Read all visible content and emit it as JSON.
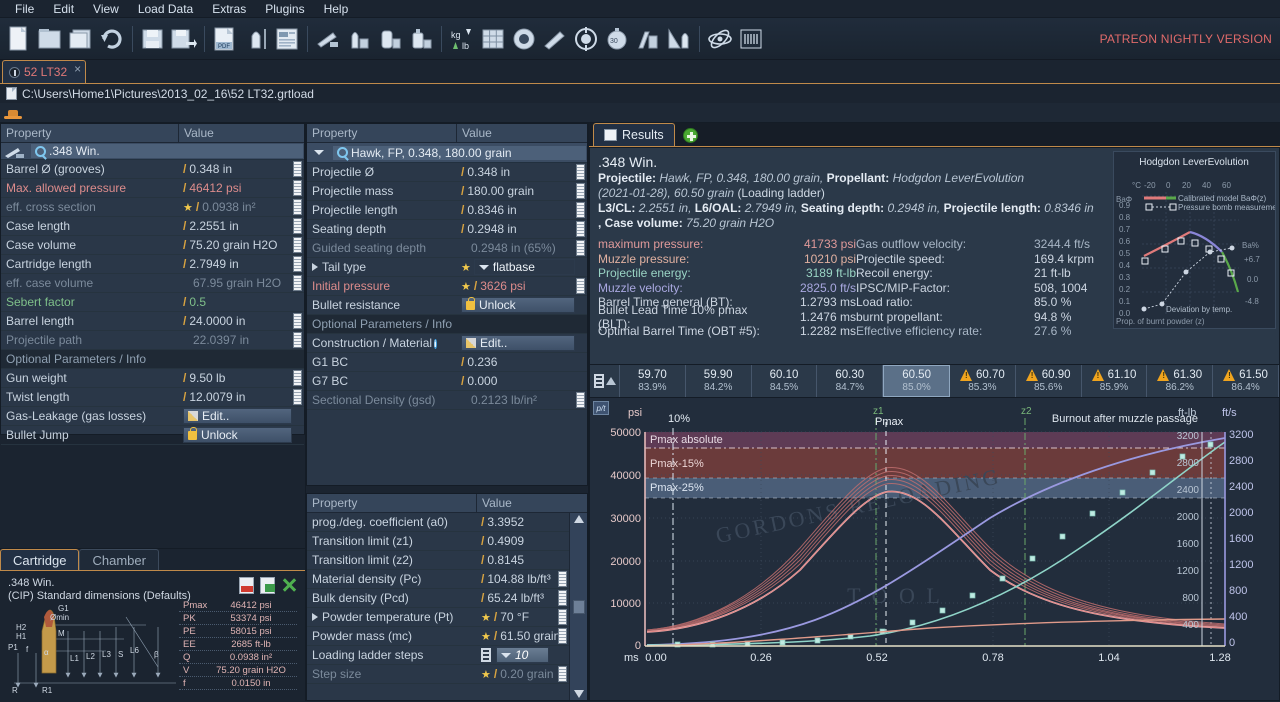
{
  "menu": {
    "items": [
      "File",
      "Edit",
      "View",
      "Load Data",
      "Extras",
      "Plugins",
      "Help"
    ]
  },
  "toolbar": {
    "patreon_label": "PATREON NIGHTLY VERSION",
    "icons": [
      "new-document-icon",
      "open-folder-icon",
      "open-recent-icon",
      "reload-icon",
      "save-icon",
      "save-as-icon",
      "export-pdf-icon",
      "cartridge-measure-icon",
      "report-icon",
      "rifle-icon",
      "bullets-icon",
      "case-icon",
      "powder-container-icon",
      "unit-convert-icon",
      "table-grid-icon",
      "primer-icon",
      "scope-icon",
      "target-icon",
      "chronograph-icon",
      "powder-mix-icon",
      "caliper-icon",
      "atom-icon",
      "strain-gauge-icon"
    ]
  },
  "document_tab": {
    "label": "52 LT32",
    "close": "×"
  },
  "path": "C:\\Users\\Home1\\Pictures\\2013_02_16\\52 LT32.grtload",
  "left_panel": {
    "header": {
      "property": "Property",
      "value": "Value"
    },
    "title": ".348 Win.",
    "rows": [
      {
        "name": "Barrel Ø (grooves)",
        "value": "0.348 in",
        "slash": true,
        "ruler": true
      },
      {
        "name": "Max. allowed pressure",
        "value": "46412 psi",
        "slash": true,
        "ruler": true,
        "style": "red"
      },
      {
        "name": "eff. cross section",
        "value": "0.0938 in²",
        "slash": true,
        "ruler": true,
        "star": true,
        "style": "muted"
      },
      {
        "name": "Case length",
        "value": "2.2551 in",
        "slash": true,
        "ruler": true
      },
      {
        "name": "Case volume",
        "value": "75.20 grain H2O",
        "slash": true,
        "ruler": true
      },
      {
        "name": "Cartridge length",
        "value": "2.7949 in",
        "slash": true,
        "ruler": true
      },
      {
        "name": "eff. case volume",
        "value": "67.95 grain H2O",
        "slash": false,
        "ruler": true,
        "style": "muted"
      },
      {
        "name": "Sebert factor",
        "value": "0.5",
        "slash": true,
        "ruler": false,
        "style": "green"
      },
      {
        "name": "Barrel length",
        "value": "24.0000 in",
        "slash": true,
        "ruler": true
      },
      {
        "name": "Projectile path",
        "value": "22.0397 in",
        "slash": false,
        "ruler": true,
        "style": "muted"
      },
      {
        "name": "Optional Parameters / Info",
        "separator": true
      },
      {
        "name": "Gun weight",
        "value": "9.50 lb",
        "slash": true,
        "ruler": true
      },
      {
        "name": "Twist length",
        "value": "12.0079 in",
        "slash": true,
        "ruler": true
      },
      {
        "name": "Gas-Leakage (gas losses)",
        "button": "Edit..",
        "button_type": "edit"
      },
      {
        "name": "Bullet Jump",
        "button": "Unlock",
        "button_type": "lock"
      }
    ]
  },
  "cartridge_panel": {
    "tabs": [
      {
        "label": "Cartridge",
        "active": true
      },
      {
        "label": "Chamber",
        "active": false
      }
    ],
    "title_line1": ".348 Win.",
    "title_line2": "(CIP) Standard dimensions (Defaults)",
    "diagram_labels": [
      "G1",
      "Ømin",
      "H2",
      "H1",
      "M",
      "P1",
      "f",
      "α",
      "L1",
      "L2",
      "L3",
      "S",
      "L6",
      "β",
      "R",
      "R1"
    ],
    "table": [
      {
        "k": "Pmax",
        "v": "46412 psi"
      },
      {
        "k": "PK",
        "v": "53374 psi"
      },
      {
        "k": "PE",
        "v": "58015 psi"
      },
      {
        "k": "EE",
        "v": "2685 ft-lb"
      },
      {
        "k": "Q",
        "v": "0.0938 in²"
      },
      {
        "k": "V",
        "v": "75.20 grain H2O"
      },
      {
        "k": "f",
        "v": "0.0150 in"
      }
    ],
    "icons": [
      "export-pdf-icon",
      "export-sheet-icon",
      "close-x-icon"
    ]
  },
  "mid_panel": {
    "header": {
      "property": "Property",
      "value": "Value"
    },
    "title": "Hawk, FP, 0.348, 180.00 grain",
    "rows": [
      {
        "name": "Projectile Ø",
        "value": "0.348 in",
        "slash": true,
        "ruler": true
      },
      {
        "name": "Projectile mass",
        "value": "180.00 grain",
        "slash": true,
        "ruler": true
      },
      {
        "name": "Projectile length",
        "value": "0.8346 in",
        "slash": true,
        "ruler": true
      },
      {
        "name": "Seating depth",
        "value": "0.2948 in",
        "slash": true,
        "ruler": true
      },
      {
        "name": "Guided seating depth",
        "value": "0.2948 in (65%)",
        "slash": false,
        "ruler": true,
        "style": "muted"
      },
      {
        "name": "Tail type",
        "combo": "flatbase",
        "star": true,
        "expander": true
      },
      {
        "name": "Initial pressure",
        "value": "3626 psi",
        "slash": true,
        "ruler": true,
        "star": true,
        "style": "red"
      },
      {
        "name": "Bullet resistance",
        "button": "Unlock",
        "button_type": "lock"
      },
      {
        "name": "Optional Parameters / Info",
        "separator": true
      },
      {
        "name": "Construction / Material",
        "button": "Edit..",
        "button_type": "edit",
        "info": true
      },
      {
        "name": "G1 BC",
        "value": "0.236",
        "slash": true
      },
      {
        "name": "G7 BC",
        "value": "0.000",
        "slash": true
      },
      {
        "name": "Sectional Density (gsd)",
        "value": "0.2123 lb/in²",
        "slash": false,
        "ruler": true,
        "style": "muted"
      }
    ]
  },
  "powder_panel": {
    "header": {
      "property": "Property",
      "value": "Value"
    },
    "rows": [
      {
        "name": "prog./deg. coefficient (a0)",
        "value": "3.3952",
        "slash": true
      },
      {
        "name": "Transition limit (z1)",
        "value": "0.4909",
        "slash": true
      },
      {
        "name": "Transition limit (z2)",
        "value": "0.8145",
        "slash": true
      },
      {
        "name": "Material density (Pc)",
        "value": "104.88 lb/ft³",
        "slash": true,
        "ruler": true
      },
      {
        "name": "Bulk density (Pcd)",
        "value": "65.24 lb/ft³",
        "slash": true,
        "ruler": true
      },
      {
        "name": "Powder temperature (Pt)",
        "value": "70 °F",
        "slash": true,
        "ruler": true,
        "star": true,
        "expander": true
      },
      {
        "name": "Powder mass (mc)",
        "value": "61.50 grain",
        "slash": true,
        "ruler": true,
        "star": true
      },
      {
        "name": "Loading ladder steps",
        "combo": "10",
        "ladder_icon": true
      },
      {
        "name": "Step size",
        "value": "0.20 grain",
        "slash": true,
        "ruler": true,
        "star": true,
        "style": "muted"
      }
    ]
  },
  "results": {
    "tab_label": "Results",
    "add_tab": "+",
    "title": ".348 Win.",
    "desc": {
      "l1_k1": "Projectile:",
      "l1_v1": "Hawk, FP, 0.348, 180.00 grain,",
      "l1_k2": "Propellant:",
      "l1_v2": "Hodgdon LeverEvolution",
      "l2_v": "(2021-01-28), 60.50 grain",
      "l2_t": "(Loading ladder)",
      "l3_k1": "L3/CL:",
      "l3_v1": "2.2551 in,",
      "l3_k2": "L6/OAL:",
      "l3_v2": "2.7949 in,",
      "l3_k3": "Seating depth:",
      "l3_v3": "0.2948 in,",
      "l3_k4": "Projectile length:",
      "l3_v4": "0.8346 in",
      "l4_k": ", Case volume:",
      "l4_v": "75.20 grain H2O"
    },
    "left_kv": [
      {
        "k": "maximum pressure:",
        "v": "41733 psi",
        "color": "#e09a9a"
      },
      {
        "k": "Muzzle pressure:",
        "v": "10210 psi",
        "color": "#e0b0a0"
      },
      {
        "k": "Projectile energy:",
        "v": "3189 ft-lb",
        "color": "#9ad4c4"
      },
      {
        "k": "Muzzle velocity:",
        "v": "2825.0 ft/s",
        "color": "#a9a8e0"
      },
      {
        "k": "Barrel Time general (BT):",
        "v": "1.2793 ms",
        "color": "#cdd6e2"
      },
      {
        "k": "Bullet Lead Time 10% pmax (BLT):",
        "v": "1.2476 ms",
        "color": "#cdd6e2"
      },
      {
        "k": "Optimal Barrel Time (OBT #5):",
        "v": "1.2282 ms",
        "color": "#cdd6e2"
      }
    ],
    "right_kv": [
      {
        "k": "Gas outflow velocity:",
        "v": "3244.4 ft/s",
        "color": "#a8b6c6"
      },
      {
        "k": "Projectile speed:",
        "v": "169.4 krpm",
        "color": "#cdd6e2"
      },
      {
        "k": "Recoil energy:",
        "v": "21 ft-lb",
        "color": "#cdd6e2"
      },
      {
        "k": "IPSC/MIP-Factor:",
        "v": "508, 1004",
        "color": "#cdd6e2"
      },
      {
        "k": "Load ratio:",
        "v": "85.0 %",
        "color": "#cdd6e2"
      },
      {
        "k": "burnt propellant:",
        "v": "94.8 %",
        "color": "#cdd6e2"
      },
      {
        "k": "Effective efficiency rate:",
        "v": "27.6 %",
        "color": "#a8b6c6"
      }
    ]
  },
  "inset_chart": {
    "title": "Hodgdon LeverEvolution",
    "y_label": "BaΦ",
    "x_label": "Prop. of burnt powder (z)",
    "temp_unit": "°C",
    "x_ticks": [
      "-20",
      "0",
      "20",
      "40",
      "60"
    ],
    "y_ticks": [
      "0.9",
      "0.8",
      "0.7",
      "0.6",
      "0.5",
      "0.4",
      "0.3",
      "0.2",
      "0.1",
      "0.0"
    ],
    "right_label": "Ba%",
    "right_ticks": [
      "+6.7",
      "0.0",
      "-4.8"
    ],
    "legend": [
      "Calibrated model BaΦ(z)",
      "Pressure bomb measurement"
    ],
    "annotation": "Deviation by temp."
  },
  "ladder": {
    "cells": [
      {
        "charge": "59.70",
        "pct": "83.9%",
        "warn": false,
        "selected": false
      },
      {
        "charge": "59.90",
        "pct": "84.2%",
        "warn": false,
        "selected": false
      },
      {
        "charge": "60.10",
        "pct": "84.5%",
        "warn": false,
        "selected": false
      },
      {
        "charge": "60.30",
        "pct": "84.7%",
        "warn": false,
        "selected": false
      },
      {
        "charge": "60.50",
        "pct": "85.0%",
        "warn": false,
        "selected": true
      },
      {
        "charge": "60.70",
        "pct": "85.3%",
        "warn": true,
        "selected": false
      },
      {
        "charge": "60.90",
        "pct": "85.6%",
        "warn": true,
        "selected": false
      },
      {
        "charge": "61.10",
        "pct": "85.9%",
        "warn": true,
        "selected": false
      },
      {
        "charge": "61.30",
        "pct": "86.2%",
        "warn": true,
        "selected": false
      },
      {
        "charge": "61.50",
        "pct": "86.4%",
        "warn": true,
        "selected": false
      }
    ]
  },
  "chart_data": {
    "type": "line",
    "title": "",
    "watermark": "GORDONS RELOADING TOOL",
    "xlabel": "ms",
    "x_ticks": [
      "0.00",
      "0.26",
      "0.52",
      "0.78",
      "1.04",
      "1.28"
    ],
    "xlim": [
      0.0,
      1.2793
    ],
    "left_axis": {
      "label": "psi",
      "ticks": [
        "0",
        "10000",
        "20000",
        "30000",
        "40000",
        "50000"
      ],
      "ylim": [
        0,
        50000
      ]
    },
    "right_axis_1": {
      "label": "ft-lb",
      "ticks": [
        "400",
        "800",
        "1200",
        "1600",
        "2000",
        "2400",
        "2800",
        "3200"
      ],
      "ylim": [
        0,
        3200
      ]
    },
    "right_axis_2": {
      "label": "ft/s",
      "ticks": [
        "0",
        "400",
        "800",
        "1200",
        "1600",
        "2000",
        "2400",
        "2800",
        "3200"
      ],
      "ylim": [
        0,
        3200
      ]
    },
    "bands": [
      {
        "label": "Pmax absolute",
        "from": 46412,
        "to": 50000,
        "color": "#5e3b55"
      },
      {
        "label": "Pmax-15%",
        "from": 39450,
        "to": 46412,
        "color": "#6b3b3b"
      },
      {
        "label": "Pmax-25%",
        "from": 34809,
        "to": 39450,
        "color": "#4a5d77"
      }
    ],
    "markers": [
      {
        "label": "10%",
        "x": 0.085,
        "style": "dash-dot",
        "color": "#dce6f0"
      },
      {
        "label": "z1",
        "x": 0.515,
        "style": "dash-dot",
        "color": "#6aa86a"
      },
      {
        "label": "Pmax",
        "x": 0.535,
        "style": "dashed",
        "color": "#e8eef5"
      },
      {
        "label": "z2",
        "x": 0.845,
        "style": "dash-dot",
        "color": "#6aa86a"
      },
      {
        "label": "Burnout after muzzle passage",
        "x": 1.25,
        "style": "dotted",
        "color": "#cdd6e2"
      }
    ],
    "series": [
      {
        "name": "Pressure (psi)",
        "color": "#e08585",
        "axis": "left",
        "points": [
          [
            0.0,
            3626
          ],
          [
            0.1,
            4000
          ],
          [
            0.2,
            5200
          ],
          [
            0.3,
            9500
          ],
          [
            0.36,
            16000
          ],
          [
            0.42,
            25500
          ],
          [
            0.47,
            33500
          ],
          [
            0.52,
            39800
          ],
          [
            0.55,
            41733
          ],
          [
            0.6,
            41000
          ],
          [
            0.66,
            37500
          ],
          [
            0.74,
            31500
          ],
          [
            0.84,
            24500
          ],
          [
            0.95,
            18500
          ],
          [
            1.06,
            14200
          ],
          [
            1.16,
            11800
          ],
          [
            1.28,
            10210
          ]
        ]
      },
      {
        "name": "Ladder pressure family",
        "color": "#c87878",
        "axis": "left",
        "family": true
      },
      {
        "name": "Projectile velocity (ft/s)",
        "color": "#9a99e0",
        "axis": "right2",
        "points": [
          [
            0.0,
            0
          ],
          [
            0.1,
            10
          ],
          [
            0.2,
            60
          ],
          [
            0.3,
            200
          ],
          [
            0.4,
            480
          ],
          [
            0.5,
            900
          ],
          [
            0.6,
            1380
          ],
          [
            0.7,
            1810
          ],
          [
            0.8,
            2160
          ],
          [
            0.9,
            2410
          ],
          [
            1.0,
            2580
          ],
          [
            1.1,
            2700
          ],
          [
            1.2,
            2780
          ],
          [
            1.28,
            2825
          ]
        ]
      },
      {
        "name": "Projectile energy (ft-lb)",
        "color": "#8fd4c8",
        "axis": "right1",
        "points": [
          [
            0.0,
            0
          ],
          [
            0.12,
            2
          ],
          [
            0.22,
            8
          ],
          [
            0.32,
            25
          ],
          [
            0.42,
            90
          ],
          [
            0.5,
            210
          ],
          [
            0.58,
            420
          ],
          [
            0.66,
            700
          ],
          [
            0.74,
            1030
          ],
          [
            0.82,
            1390
          ],
          [
            0.9,
            1740
          ],
          [
            0.98,
            2060
          ],
          [
            1.06,
            2350
          ],
          [
            1.14,
            2600
          ],
          [
            1.22,
            2800
          ],
          [
            1.28,
            3189
          ]
        ]
      },
      {
        "name": "Gas outflow / efficiency",
        "color": "#e09a8a",
        "axis": "left",
        "points": [
          [
            0.0,
            0
          ],
          [
            0.3,
            150
          ],
          [
            0.6,
            420
          ],
          [
            0.9,
            640
          ],
          [
            1.1,
            700
          ],
          [
            1.28,
            720
          ]
        ]
      }
    ]
  }
}
